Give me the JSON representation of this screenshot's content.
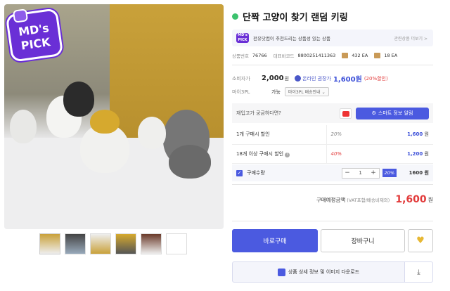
{
  "product": {
    "title": "단짝 고양이 찾기 랜덤 키링",
    "badge_line1": "MD's",
    "badge_line2": "PICK"
  },
  "md_pick": {
    "mini_line1": "MD's",
    "mini_line2": "PICK",
    "text": "전유닷컴이 추천드리는 상품성 있는 상품",
    "more": "관련상품 더보기 >"
  },
  "meta": {
    "code_label": "상품번호",
    "code": "76766",
    "barcode_label": "대표바코드",
    "barcode": "8800251411363",
    "qty1": "432 EA",
    "qty2": "18 EA"
  },
  "price": {
    "consumer_label": "소비자가",
    "consumer": "2,000",
    "won": "원",
    "online_label": "온라인 권장가",
    "online": "1,600원",
    "discount": "(20%할인)"
  },
  "mai3pl": {
    "label": "마이3PL",
    "avail": "가능",
    "button": "마이3PL 배송안내 ⌄"
  },
  "stock": {
    "question": "재입고가 궁금하다면?",
    "smart_label": "스마트 정보 알림"
  },
  "discount_table": [
    {
      "label": "1개 구매시 할인",
      "rate": "20%",
      "price": "1,600",
      "won": "원"
    },
    {
      "label": "18개 이상 구매시 할인",
      "rate": "40%",
      "price": "1,200",
      "won": "원"
    }
  ],
  "quantity": {
    "label": "구매수량",
    "minus": "−",
    "value": "1",
    "plus": "+",
    "rate": "20%",
    "price": "1600 원"
  },
  "total": {
    "label": "구매예정금액",
    "sub": "(VAT포함/배송비제외)",
    "price": "1,600",
    "won": "원"
  },
  "buttons": {
    "buy": "바로구매",
    "cart": "장바구니",
    "heart": "♥",
    "download": "상품 상세 정보 및 이미지 다운로드",
    "download_side": "⤓"
  },
  "colors": {
    "primary": "#4b5ae0",
    "price_red": "#e23b3b",
    "badge_purple": "#6a2fd6"
  }
}
